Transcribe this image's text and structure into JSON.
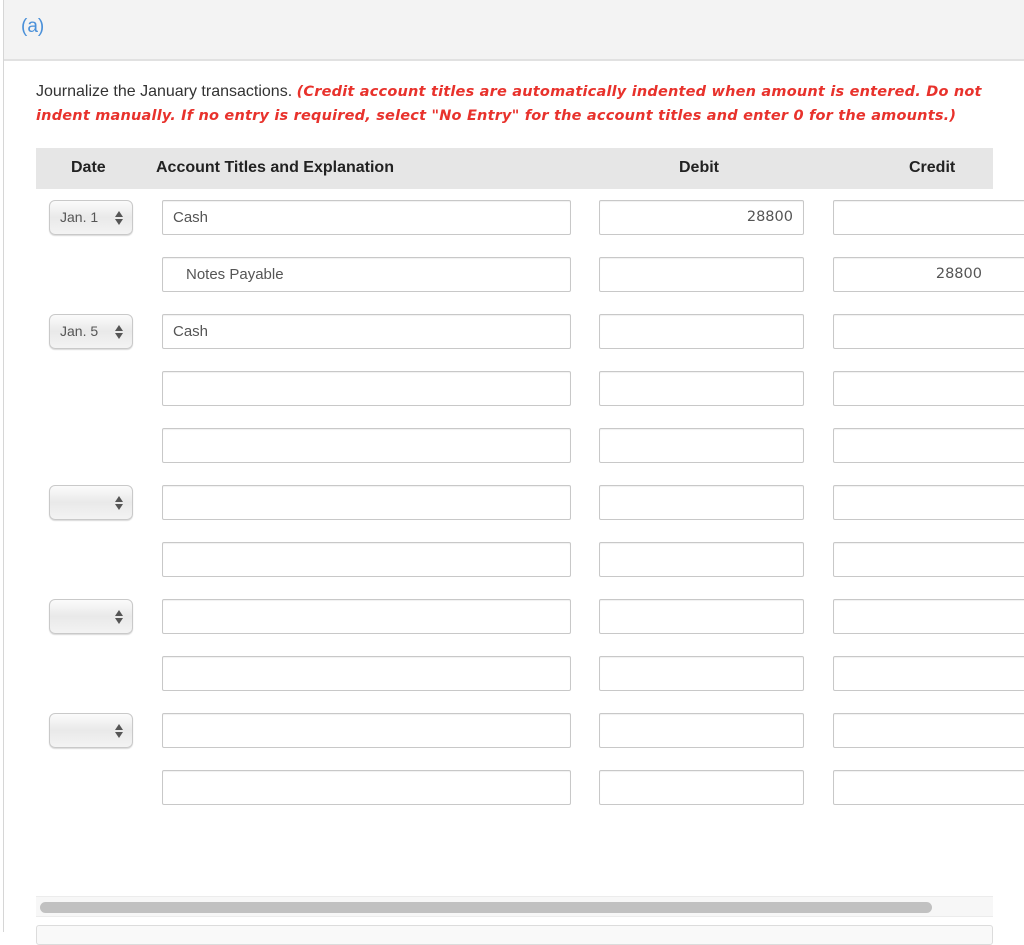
{
  "part": {
    "label": "(a)"
  },
  "instructions": {
    "text": "Journalize the January transactions. ",
    "note": "(Credit account titles are automatically indented when amount is entered. Do not indent manually. If no entry is required, select \"No Entry\" for the account titles and enter 0 for the amounts.)"
  },
  "table": {
    "headers": {
      "date": "Date",
      "account": "Account Titles and Explanation",
      "debit": "Debit",
      "credit": "Credit"
    },
    "rows": [
      {
        "date": "Jan. 1",
        "has_date": true,
        "account": "Cash",
        "indent": false,
        "debit": "28800",
        "credit": ""
      },
      {
        "date": "",
        "has_date": false,
        "account": "Notes Payable",
        "indent": true,
        "debit": "",
        "credit": "28800"
      },
      {
        "date": "Jan. 5",
        "has_date": true,
        "account": "Cash",
        "indent": false,
        "debit": "",
        "credit": ""
      },
      {
        "date": "",
        "has_date": false,
        "account": "",
        "indent": false,
        "debit": "",
        "credit": ""
      },
      {
        "date": "",
        "has_date": false,
        "account": "",
        "indent": false,
        "debit": "",
        "credit": ""
      },
      {
        "date": "",
        "has_date": true,
        "account": "",
        "indent": false,
        "debit": "",
        "credit": ""
      },
      {
        "date": "",
        "has_date": false,
        "account": "",
        "indent": false,
        "debit": "",
        "credit": ""
      },
      {
        "date": "",
        "has_date": true,
        "account": "",
        "indent": false,
        "debit": "",
        "credit": ""
      },
      {
        "date": "",
        "has_date": false,
        "account": "",
        "indent": false,
        "debit": "",
        "credit": ""
      },
      {
        "date": "",
        "has_date": true,
        "account": "",
        "indent": false,
        "debit": "",
        "credit": ""
      },
      {
        "date": "",
        "has_date": false,
        "account": "",
        "indent": false,
        "debit": "",
        "credit": ""
      },
      {
        "date": "",
        "has_date": false,
        "account": "",
        "indent": false,
        "debit": "",
        "credit": ""
      }
    ]
  },
  "icons": {
    "select_arrows": "up-down-arrows-icon"
  },
  "colors": {
    "part_label": "#4a90d9",
    "note": "#e8322c",
    "header_bg": "#e6e6e6"
  }
}
